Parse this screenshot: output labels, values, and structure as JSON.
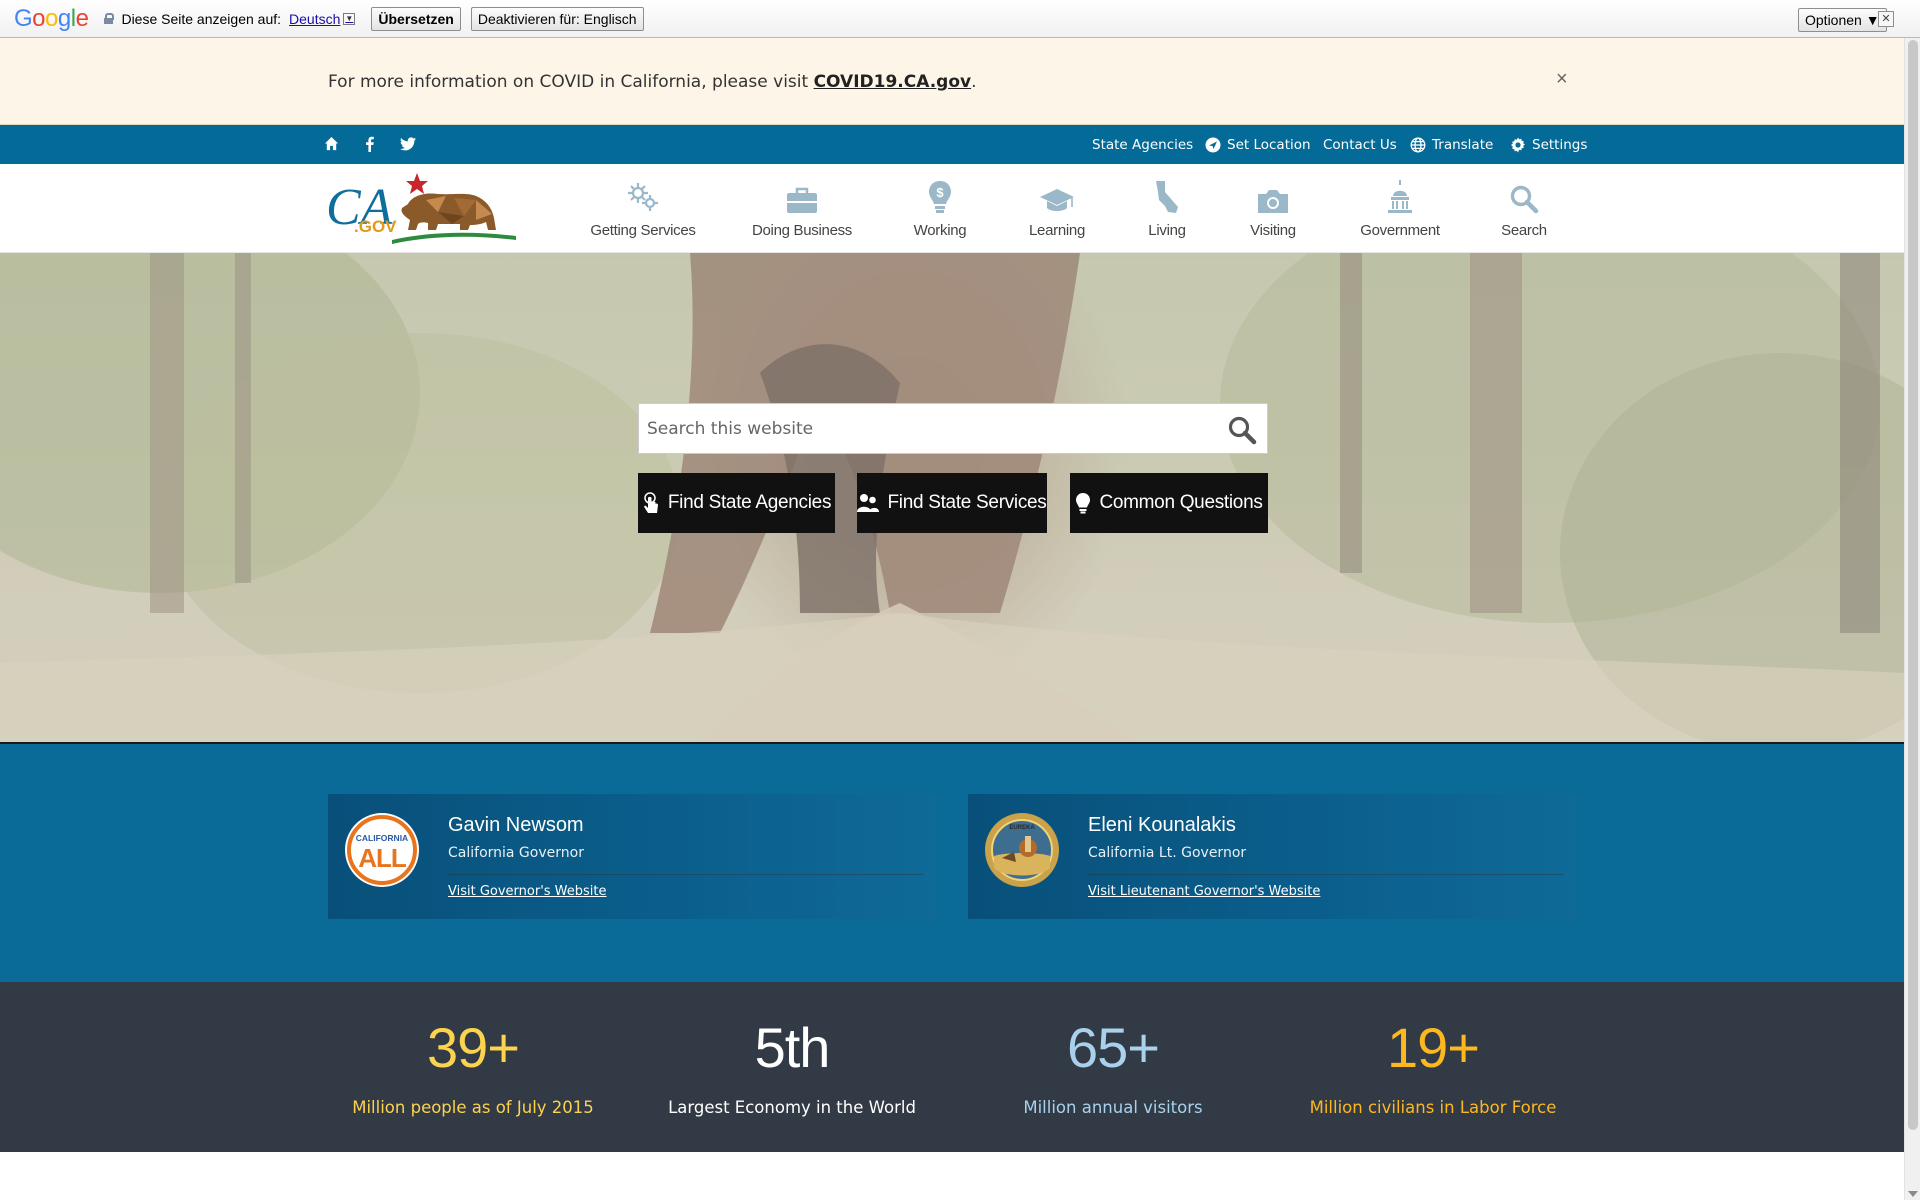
{
  "translate_bar": {
    "brand": "Google",
    "show_page_in": "Diese Seite anzeigen auf:",
    "language": "Deutsch",
    "translate_button": "Übersetzen",
    "deactivate_button": "Deaktivieren für: Englisch",
    "options_button": "Optionen ▼",
    "close": "✕"
  },
  "alert": {
    "text": "For more information on COVID in California, please visit ",
    "link": "COVID19.CA.gov",
    "suffix": ".",
    "close": "×"
  },
  "utility": {
    "state_agencies": "State Agencies",
    "set_location": "Set Location",
    "contact_us": "Contact Us",
    "translate": "Translate",
    "settings": "Settings"
  },
  "logo": {
    "text": "CA",
    "sub": ".GOV"
  },
  "nav": [
    {
      "label": "Getting Services",
      "icon": "gears-icon"
    },
    {
      "label": "Doing Business",
      "icon": "briefcase-icon"
    },
    {
      "label": "Working",
      "icon": "lightbulb-dollar-icon"
    },
    {
      "label": "Learning",
      "icon": "graduation-cap-icon"
    },
    {
      "label": "Living",
      "icon": "california-icon"
    },
    {
      "label": "Visiting",
      "icon": "camera-icon"
    },
    {
      "label": "Government",
      "icon": "capitol-icon"
    },
    {
      "label": "Search",
      "icon": "search-icon"
    }
  ],
  "hero": {
    "search_placeholder": "Search this website",
    "buttons": [
      "Find State Agencies",
      "Find State Services",
      "Common Questions"
    ]
  },
  "officials": [
    {
      "name": "Gavin Newsom",
      "role": "California Governor",
      "link": "Visit Governor's Website",
      "badge_top": "CALIFORNIA",
      "badge_main": "ALL"
    },
    {
      "name": "Eleni Kounalakis",
      "role": "California Lt. Governor",
      "link": "Visit Lieutenant Governor's Website",
      "badge_top": "EUREKA"
    }
  ],
  "stats": [
    {
      "value": "39+",
      "desc": "Million people as of July 2015",
      "color": "#fcd34d"
    },
    {
      "value": "5th",
      "desc": "Largest Economy in the World",
      "color": "#ffffff"
    },
    {
      "value": "65+",
      "desc": "Million annual visitors",
      "color": "#a9d1ec"
    },
    {
      "value": "19+",
      "desc": "Million civilians in Labor Force",
      "color": "#fdb81e"
    }
  ],
  "colors": {
    "utility_bar": "#046b99",
    "officials_bg": "#0a6b99",
    "stats_bg": "#323a45",
    "alert_bg": "#fdf6e8"
  }
}
